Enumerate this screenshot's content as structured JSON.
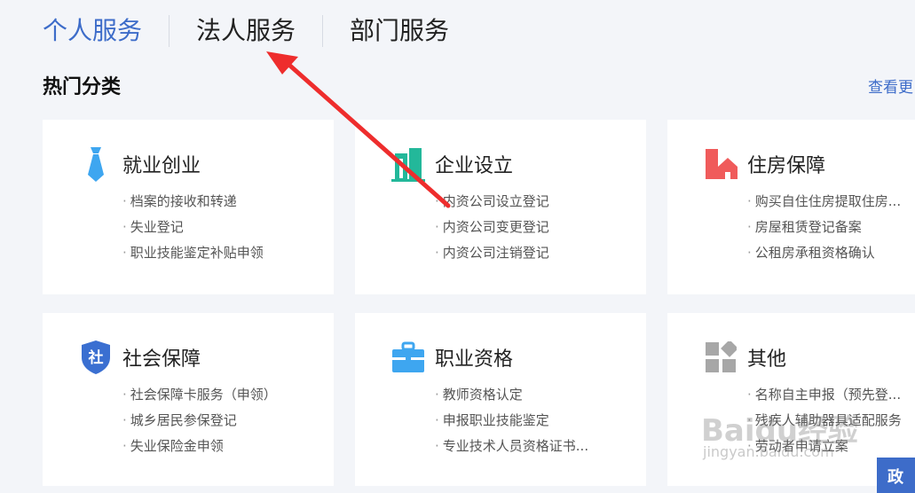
{
  "tabs": [
    {
      "label": "个人服务"
    },
    {
      "label": "法人服务"
    },
    {
      "label": "部门服务"
    }
  ],
  "section": {
    "title": "热门分类",
    "more": "查看更"
  },
  "cards": [
    {
      "title": "就业创业",
      "icon": "tie-icon",
      "items": [
        "档案的接收和转递",
        "失业登记",
        "职业技能鉴定补贴申领"
      ]
    },
    {
      "title": "企业设立",
      "icon": "building-icon",
      "items": [
        "内资公司设立登记",
        "内资公司变更登记",
        "内资公司注销登记"
      ]
    },
    {
      "title": "住房保障",
      "icon": "house-icon",
      "items": [
        "购买自住住房提取住房...",
        "房屋租赁登记备案",
        "公租房承租资格确认"
      ]
    },
    {
      "title": "社会保障",
      "icon": "shield-icon",
      "icon_text": "社",
      "items": [
        "社会保障卡服务（申领）",
        "城乡居民参保登记",
        "失业保险金申领"
      ]
    },
    {
      "title": "职业资格",
      "icon": "briefcase-icon",
      "items": [
        "教师资格认定",
        "申报职业技能鉴定",
        "专业技术人员资格证书..."
      ]
    },
    {
      "title": "其他",
      "icon": "grid-icon",
      "items": [
        "名称自主申报（预先登...",
        "残疾人辅助器具适配服务",
        "劳动者申请立案"
      ]
    }
  ],
  "badge": {
    "label": "政"
  },
  "watermark": {
    "line1": "Baidu经验",
    "line2": "jingyan.baidu.com"
  },
  "colors": {
    "accent": "#3d6cc9",
    "arrow": "#ee2d2d",
    "tie": "#3ea6f0",
    "building": "#23b89a",
    "house": "#f05b5b",
    "shield": "#3a6fd1",
    "briefcase": "#3ea6f0",
    "grid": "#a7a7a7"
  }
}
